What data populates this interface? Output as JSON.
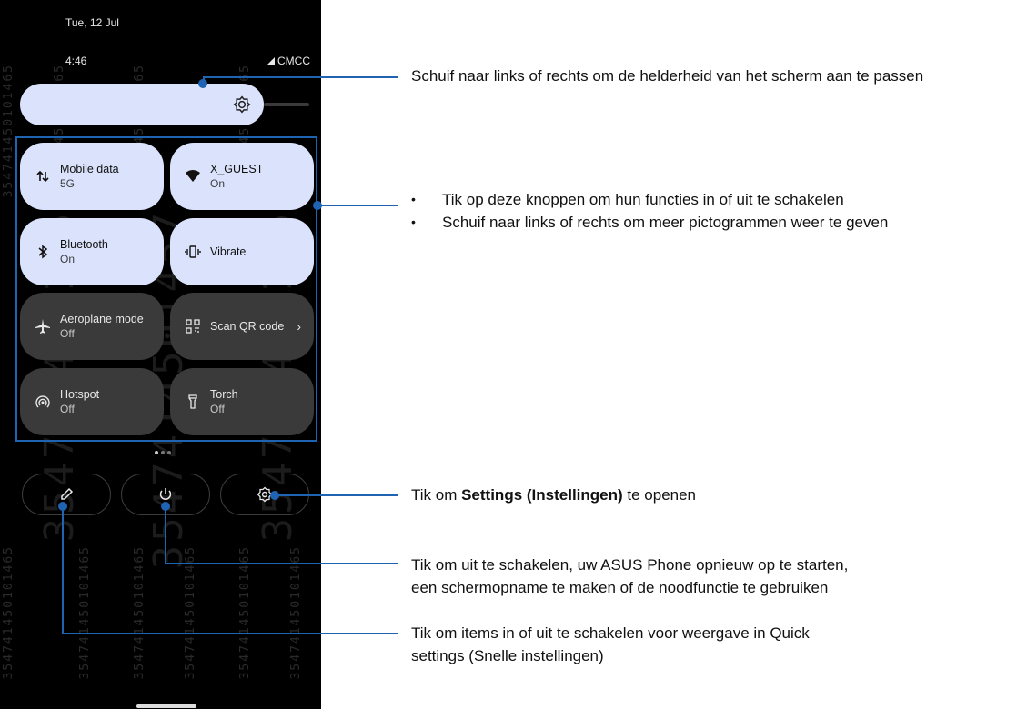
{
  "status_bar": {
    "date": "Tue, 12 Jul",
    "time": "4:46",
    "carrier": "CMCC",
    "signal_icon": "signal-icon"
  },
  "brightness": {
    "icon": "brightness-icon"
  },
  "tiles": [
    {
      "title": "Mobile data",
      "subtitle": "5G",
      "icon": "mobile-data-icon",
      "state": "on"
    },
    {
      "title": "X_GUEST",
      "subtitle": "On",
      "icon": "wifi-icon",
      "state": "on"
    },
    {
      "title": "Bluetooth",
      "subtitle": "On",
      "icon": "bluetooth-icon",
      "state": "on"
    },
    {
      "title": "Vibrate",
      "subtitle": "",
      "icon": "vibrate-icon",
      "state": "on"
    },
    {
      "title": "Aeroplane mode",
      "subtitle": "Off",
      "icon": "airplane-icon",
      "state": "off"
    },
    {
      "title": "Scan QR code",
      "subtitle": "",
      "icon": "qr-code-icon",
      "state": "off"
    },
    {
      "title": "Hotspot",
      "subtitle": "Off",
      "icon": "hotspot-icon",
      "state": "off"
    },
    {
      "title": "Torch",
      "subtitle": "Off",
      "icon": "torch-icon",
      "state": "off"
    }
  ],
  "watermark": {
    "big": "3547414501457",
    "small": "354741450101465"
  },
  "callouts": {
    "brightness": "Schuif naar links of rechts om de helderheid van het scherm aan te passen",
    "tiles_bullets": [
      "Tik op deze knoppen om hun functies in of uit te schakelen",
      "Schuif naar links of rechts om meer pictogrammen weer te geven"
    ],
    "settings_prefix": "Tik om ",
    "settings_bold": "Settings (Instellingen)",
    "settings_suffix": " te openen",
    "power_line1": "Tik om uit te schakelen, uw ASUS Phone opnieuw op te starten,",
    "power_line2": "een schermopname te maken of de noodfunctie te gebruiken",
    "edit_line1": "Tik om items in of uit te schakelen voor weergave in Quick",
    "edit_line2": "settings (Snelle instellingen)"
  },
  "colors": {
    "accent": "#1f63b3",
    "tile_on": "#dbe2fb",
    "tile_off": "#3a3a3a",
    "background_phone": "#000000"
  }
}
